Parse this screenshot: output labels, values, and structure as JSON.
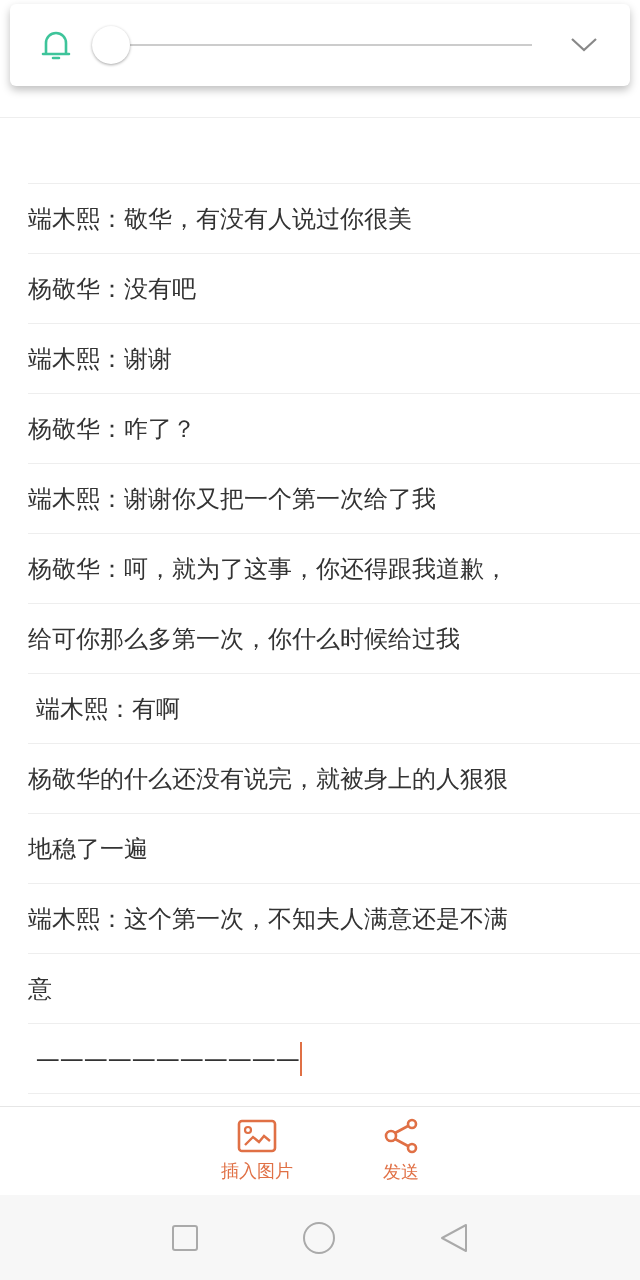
{
  "volume_panel": {
    "level": 0
  },
  "note": {
    "lines": [
      {
        "text": "端木熙：敬华，有没有人说过你很美",
        "caret": false
      },
      {
        "text": "杨敬华：没有吧",
        "caret": false
      },
      {
        "text": "端木熙：谢谢",
        "caret": false
      },
      {
        "text": "杨敬华：咋了？",
        "caret": false
      },
      {
        "text": "端木熙：谢谢你又把一个第一次给了我",
        "caret": false
      },
      {
        "text": "杨敬华：呵，就为了这事，你还得跟我道歉，",
        "caret": false
      },
      {
        "text": "给可你那么多第一次，你什么时候给过我",
        "caret": false
      },
      {
        "text": " 端木熙：有啊",
        "caret": false
      },
      {
        "text": "杨敬华的什么还没有说完，就被身上的人狠狠",
        "caret": false
      },
      {
        "text": "地稳了一遍",
        "caret": false
      },
      {
        "text": "端木熙：这个第一次，不知夫人满意还是不满",
        "caret": false
      },
      {
        "text": "意",
        "caret": false
      },
      {
        "text": " ———————————",
        "caret": true
      }
    ]
  },
  "toolbar": [
    {
      "kind": "image",
      "label": "插入图片"
    },
    {
      "kind": "share",
      "label": "发送"
    }
  ]
}
